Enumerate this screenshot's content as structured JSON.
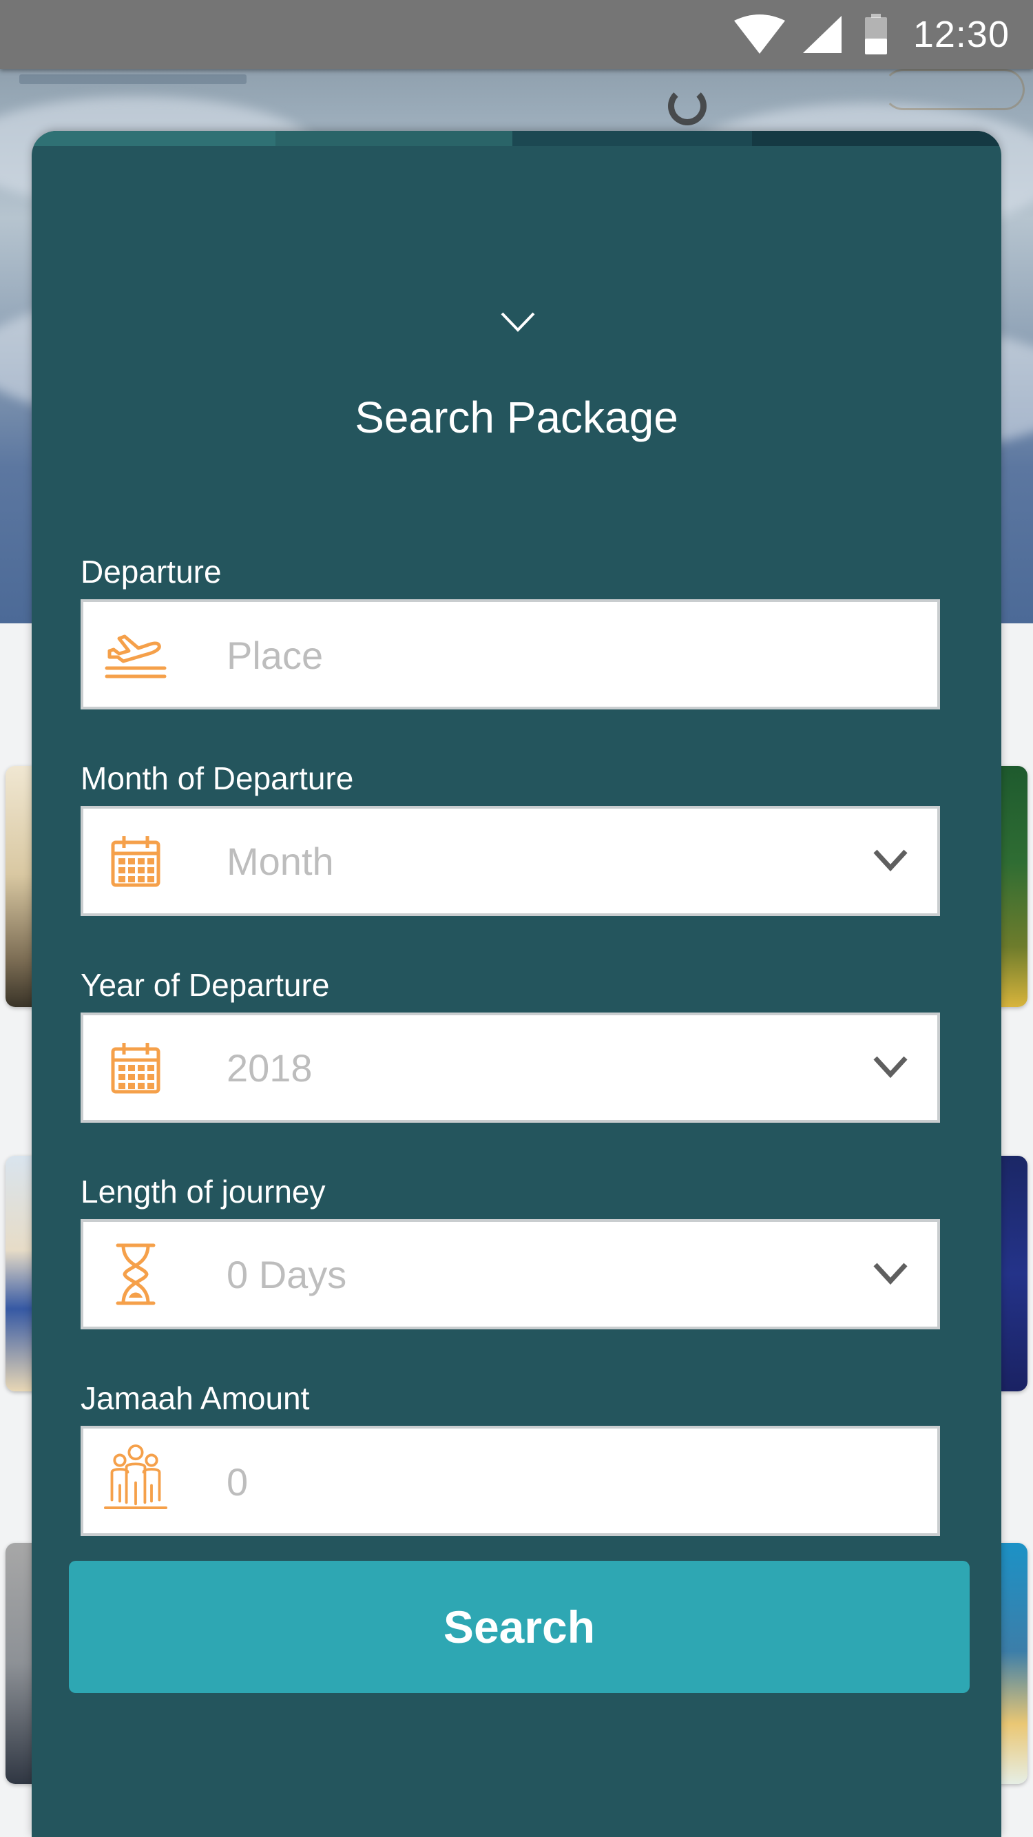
{
  "status_bar": {
    "time": "12:30",
    "icons": [
      "wifi-icon",
      "cell-signal-icon",
      "battery-icon"
    ]
  },
  "colors": {
    "sheet_background": "#24555d",
    "accent_orange": "#f5a04a",
    "search_button": "#2ea7b3",
    "placeholder_text": "#bdbdbd"
  },
  "sheet": {
    "title": "Search Package",
    "collapse_icon": "chevron-down-icon",
    "fields": {
      "departure": {
        "label": "Departure",
        "placeholder": "Place",
        "icon": "plane-takeoff-icon"
      },
      "month": {
        "label": "Month of Departure",
        "value": "Month",
        "icon": "calendar-icon"
      },
      "year": {
        "label": "Year of Departure",
        "value": "2018",
        "icon": "calendar-icon"
      },
      "length": {
        "label": "Length of journey",
        "value": "0 Days",
        "icon": "hourglass-icon"
      },
      "jamaah": {
        "label": "Jamaah Amount",
        "placeholder": "0",
        "icon": "group-people-icon"
      }
    },
    "search_label": "Search"
  }
}
